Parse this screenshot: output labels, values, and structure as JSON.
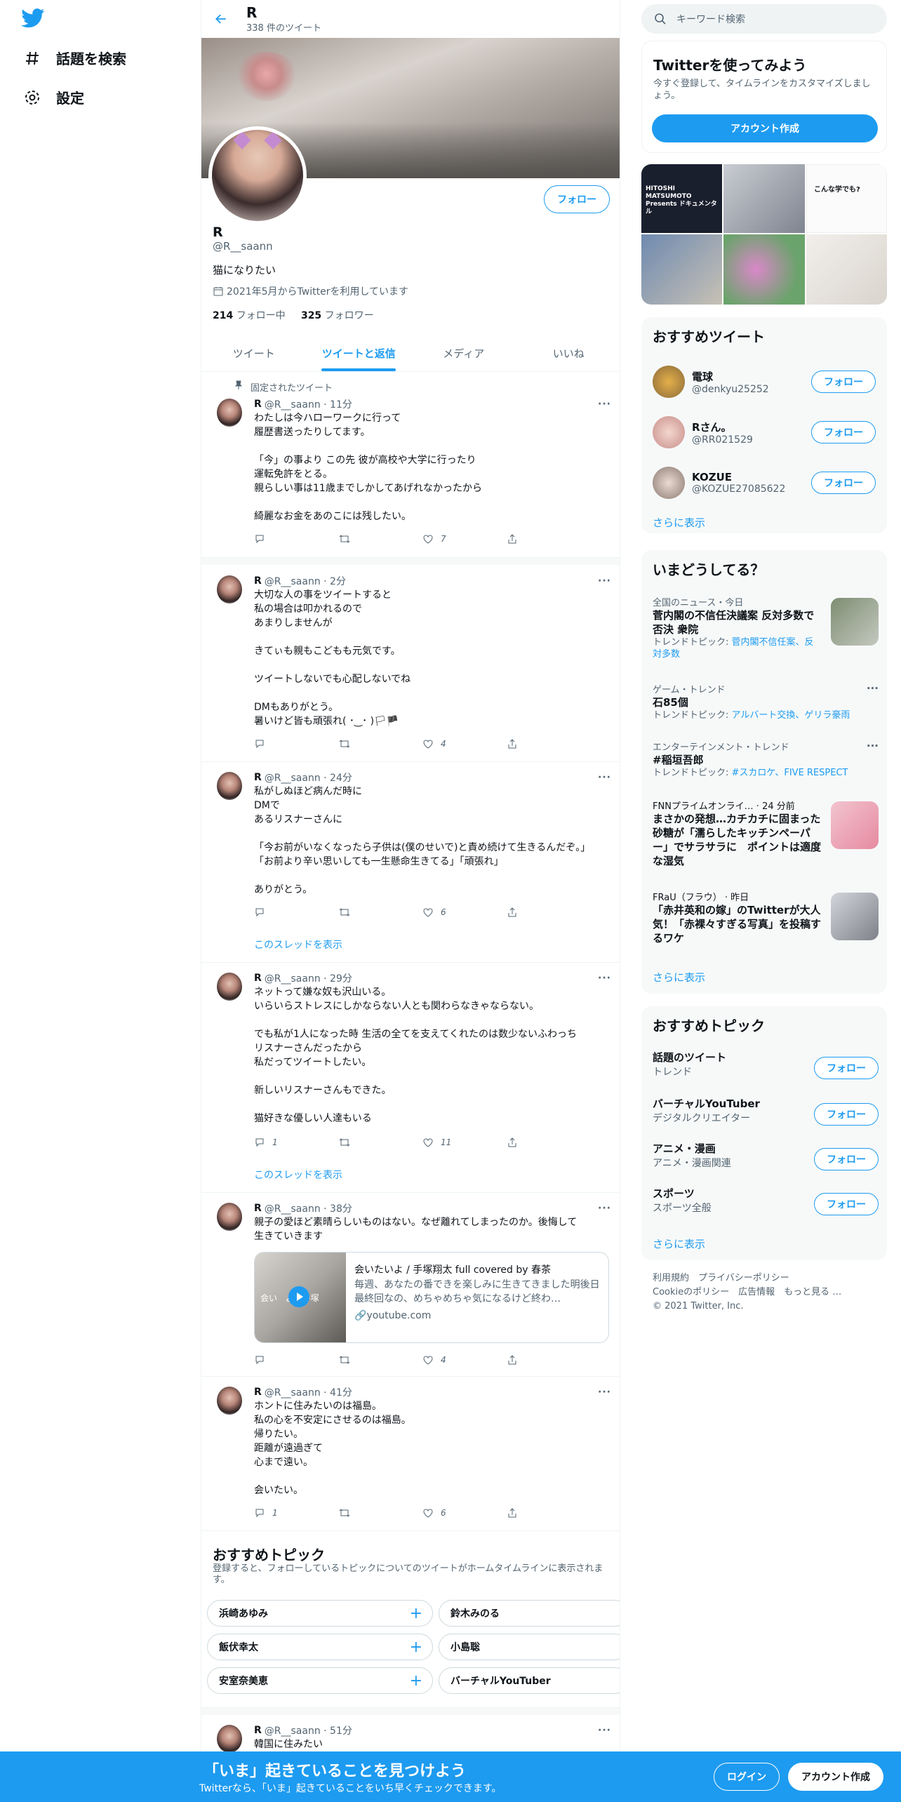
{
  "nav": {
    "items": [
      {
        "label": "話題を検索",
        "icon": "hash-icon"
      },
      {
        "label": "設定",
        "icon": "gear-icon"
      }
    ]
  },
  "header": {
    "name": "R",
    "count": "338 件のツイート"
  },
  "profile": {
    "follow_label": "フォロー",
    "name": "R",
    "handle": "@R__saann",
    "bio": "猫になりたい",
    "joined": "2021年5月からTwitterを利用しています",
    "following_count": "214",
    "following_label": "フォロー中",
    "followers_count": "325",
    "followers_label": "フォロワー"
  },
  "tabs": [
    "ツイート",
    "ツイートと返信",
    "メディア",
    "いいね"
  ],
  "pinned_label": "固定されたツイート",
  "tweets": [
    {
      "name": "R",
      "meta": "@R__saann · 11分",
      "text": "わたしは今ハローワークに行って\n履歴書送ったりしてます。\n\n「今」の事より この先 彼が高校や大学に行ったり\n運転免許をとる。\n親らしい事は11歳までしかしてあげれなかったから\n\n綺麗なお金をあのこには残したい。",
      "replies": "",
      "retweets": "",
      "likes": "7"
    },
    {
      "name": "R",
      "meta": "@R__saann · 2分",
      "text": "大切な人の事をツイートすると\n私の場合は叩かれるので\nあまりしませんが\n\nきてぃも親もこどもも元気です。\n\nツイートしないでも心配しないでね\n\nDMもありがとう。\n 暑いけど皆も頑張れ(  ･‿･ )🏳🏴",
      "replies": "",
      "retweets": "",
      "likes": "4"
    },
    {
      "name": "R",
      "meta": "@R__saann · 24分",
      "text": "私がしぬほど病んだ時に\nDMで\nあるリスナーさんに\n\n「今お前がいなくなったら子供は(僕のせいで)と責め続けて生きるんだぞ。」\n「お前より辛い思いしても一生懸命生きてる」｢頑張れ｣\n\nありがとう。",
      "replies": "",
      "retweets": "",
      "likes": "6",
      "thread": "このスレッドを表示"
    },
    {
      "name": "R",
      "meta": "@R__saann · 29分",
      "text": "ネットって嫌な奴も沢山いる。\nいらいらストレスにしかならない人とも関わらなきゃならない。\n\nでも私が1人になった時 生活の全てを支えてくれたのは数少ないふわっち\nリスナーさんだったから\n私だってツイートしたい。\n\n新しいリスナーさんもできた。\n\n猫好きな優しい人達もいる",
      "replies": "1",
      "retweets": "",
      "likes": "11",
      "thread": "このスレッドを表示"
    },
    {
      "name": "R",
      "meta": "@R__saann · 38分",
      "text": "親子の愛ほど素晴らしいものはない。なぜ離れてしまったのか。後悔して\n生きていきます",
      "replies": "",
      "retweets": "",
      "likes": "4",
      "card": {
        "title": "会いたいよ / 手塚翔太 full covered by 春茶",
        "desc": "毎週、あなたの番できを楽しみに生きてきました明後日最終回なの、めちゃめちゃ気になるけど終わ…",
        "link": "youtube.com",
        "thumb_text": "会い　よ / 手塚"
      }
    },
    {
      "name": "R",
      "meta": "@R__saann · 41分",
      "text": "ホントに住みたいのは福島。\n私の心を不安定にさせるのは福島。\n帰りたい。\n距離が遠過ぎて\n心まで遠い。\n\n会いたい。",
      "replies": "1",
      "retweets": "",
      "likes": "6"
    },
    {
      "name": "R",
      "meta": "@R__saann · 51分",
      "text": "韓国に住みたい"
    }
  ],
  "topics_block": {
    "title": "おすすめトピック",
    "desc": "登録すると、フォローしているトピックについてのツイートがホームタイムラインに表示されます。",
    "chips": [
      "浜崎あゆみ",
      "鈴木みのる",
      "飯伏幸太",
      "小島聡",
      "安室奈美恵",
      "バーチャルYouTuber"
    ]
  },
  "search": {
    "placeholder": "キーワード検索"
  },
  "try_panel": {
    "title": "Twitterを使ってみよう",
    "desc": "今すぐ登録して、タイムラインをカスタマイズしましょう。",
    "button": "アカウント作成"
  },
  "photos": {
    "p1_line1": "HITOSHI MATSUMOTO",
    "p1_line2": "Presents ドキュメンタル",
    "p3_text": "こんな学でも?"
  },
  "who": {
    "title": "おすすめツイート",
    "users": [
      {
        "name": "電球",
        "handle": "@denkyu25252"
      },
      {
        "name": "Rさん。",
        "handle": "@RR021529"
      },
      {
        "name": "KOZUE",
        "handle": "@KOZUE27085622"
      }
    ],
    "follow": "フォロー",
    "more": "さらに表示"
  },
  "trends": {
    "title": "いまどうしてる？",
    "items": [
      {
        "cat": "全国のニュース・今日",
        "title": "菅内閣の不信任決議案 反対多数で否決 衆院",
        "sub_prefix": "トレンドトピック: ",
        "sub_links": "菅内閣不信任案、反対多数"
      },
      {
        "cat": "ゲーム・トレンド",
        "title": "石85個",
        "sub_prefix": "トレンドトピック: ",
        "sub_links": "アルバート交換、ゲリラ豪雨"
      },
      {
        "cat": "エンターテインメント・トレンド",
        "title": "#稲垣吾郎",
        "sub_prefix": "トレンドトピック: ",
        "sub_links": "#スカロケ、FIVE RESPECT"
      },
      {
        "cat": "FNNプライムオンライ… · 24 分前",
        "title": "まさかの発想…カチカチに固まった砂糖が「濡らしたキッチンペーパー」でサラサラに　ポイントは適度な湿気"
      },
      {
        "cat": "FRaU（フラウ） · 昨日",
        "title": "「赤井英和の嫁」のTwitterが大人気！「赤裸々すぎる写真」を投稿するワケ"
      }
    ],
    "more": "さらに表示"
  },
  "topics_panel": {
    "title": "おすすめトピック",
    "items": [
      {
        "name": "話題のツイート",
        "sub": "トレンド"
      },
      {
        "name": "バーチャルYouTuber",
        "sub": "デジタルクリエイター"
      },
      {
        "name": "アニメ・漫画",
        "sub": "アニメ・漫画関連"
      },
      {
        "name": "スポーツ",
        "sub": "スポーツ全般"
      }
    ],
    "follow": "フォロー",
    "more": "さらに表示"
  },
  "footer": {
    "line1": "利用規約　プライバシーポリシー",
    "line2": "Cookieのポリシー　広告情報　もっと見る …",
    "line3": "© 2021 Twitter, Inc."
  },
  "bottom": {
    "title": "「いま」起きていることを見つけよう",
    "sub": "Twitterなら、「いま」起きていることをいち早くチェックできます。",
    "login": "ログイン",
    "signup": "アカウント作成"
  },
  "colors": {
    "accent": "#1d9bf0",
    "text": "#0f1419",
    "muted": "#536471"
  }
}
